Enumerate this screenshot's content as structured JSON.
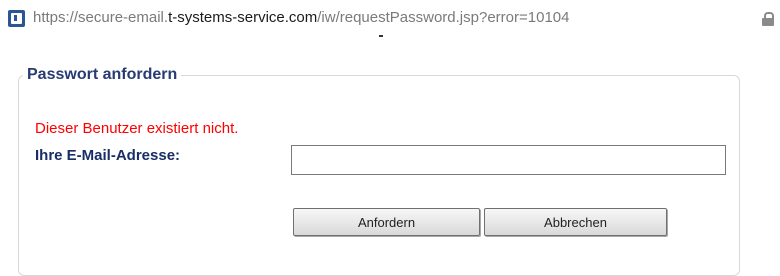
{
  "browser": {
    "url_prefix": "https://secure-email.",
    "url_domain": "t-systems-service.com",
    "url_path": "/iw/requestPassword.jsp?error=10104",
    "lock_icon": "lock-icon",
    "site_icon": "site-icon"
  },
  "form": {
    "legend": "Passwort anfordern",
    "error_message": "Dieser Benutzer existiert nicht.",
    "email_label": "Ihre E-Mail-Adresse:",
    "email_value": "",
    "request_button": "Anfordern",
    "cancel_button": "Abbrechen"
  },
  "colors": {
    "error": "#ff0000",
    "heading": "#283b73",
    "label": "#1a2e66"
  }
}
